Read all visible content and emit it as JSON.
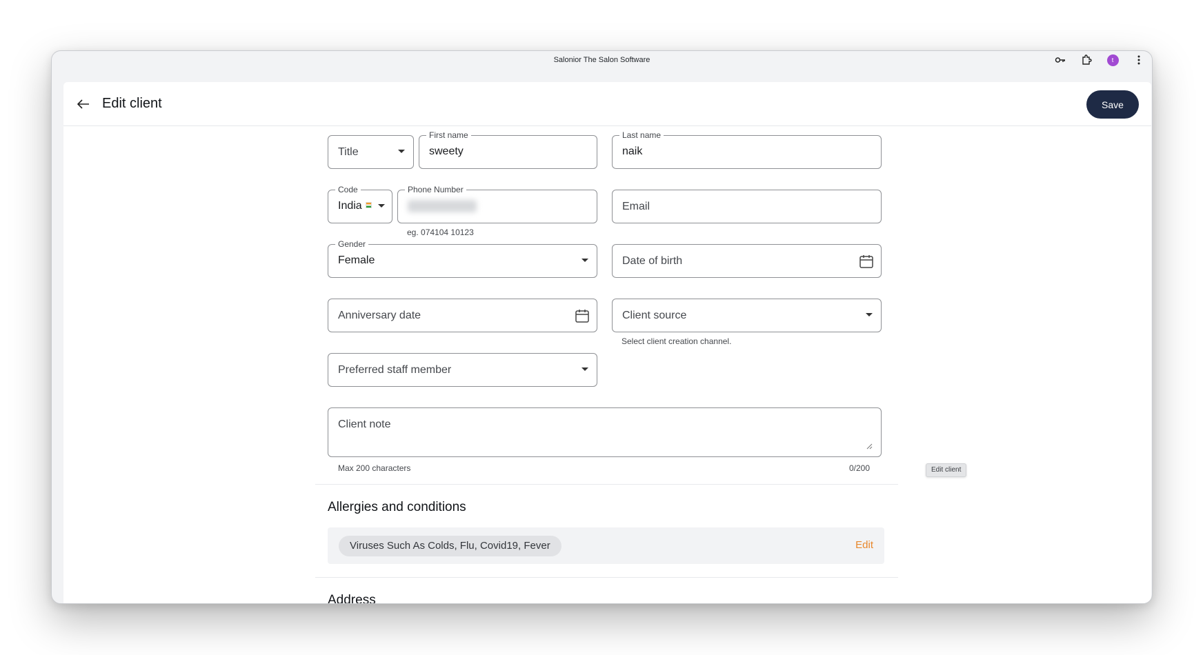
{
  "window": {
    "title": "Salonior The Salon Software",
    "toolbar_icons": [
      "key-icon",
      "extension-icon",
      "profile-avatar",
      "more-vert-icon"
    ],
    "avatar_initial": "t"
  },
  "header": {
    "title": "Edit client",
    "save_label": "Save"
  },
  "form": {
    "title": {
      "placeholder": "Title"
    },
    "first_name": {
      "label": "First name",
      "value": "sweety"
    },
    "last_name": {
      "label": "Last name",
      "value": "naik"
    },
    "code": {
      "label": "Code",
      "value": "India"
    },
    "phone": {
      "label": "Phone Number",
      "helper": "eg. 074104 10123"
    },
    "email": {
      "placeholder": "Email"
    },
    "gender": {
      "label": "Gender",
      "value": "Female"
    },
    "dob": {
      "placeholder": "Date of birth"
    },
    "anniversary": {
      "placeholder": "Anniversary date"
    },
    "client_source": {
      "placeholder": "Client source",
      "helper": "Select client creation channel."
    },
    "preferred_staff": {
      "placeholder": "Preferred staff member"
    },
    "client_note": {
      "placeholder": "Client note",
      "helper": "Max 200 characters",
      "counter": "0/200"
    }
  },
  "allergies": {
    "title": "Allergies and conditions",
    "chip": "Viruses Such As Colds, Flu, Covid19, Fever",
    "edit_label": "Edit"
  },
  "address": {
    "title": "Address"
  },
  "tooltip": {
    "text": "Edit client"
  }
}
